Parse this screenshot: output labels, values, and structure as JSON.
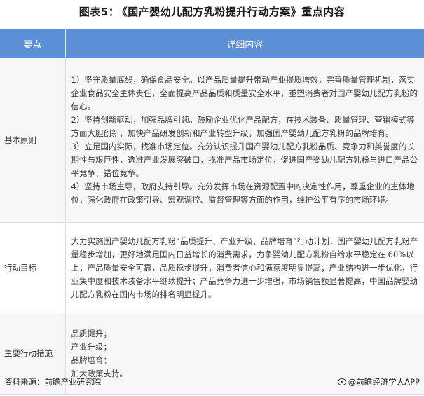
{
  "title": {
    "label": "图表5：",
    "text": "《国产婴幼儿配方乳粉提升行动方案》重点内容"
  },
  "table": {
    "headers": [
      "要点",
      "详细内容"
    ],
    "rows": [
      {
        "key": "基本原则",
        "paragraphs": [
          "1）坚守质量底线，确保食品安全。以产品质量提升带动产业提质增效，完善质量管理机制，落实企业食品安全主体责任，全面提高产品品质和质量安全水平，重塑消费者对国产婴幼儿配方乳粉的信心。",
          "2）坚持创新驱动，加强品牌引领。鼓励企业优化产品配方，在技术装备、质量管理、营销模式等方面大胆创新，加快产品研发创新和产业转型升级，加强国产婴幼儿配方乳粉的品牌培育。",
          "3）立足国内实际，找准市场定位。充分认识提升国产婴幼儿配方乳粉品质、竞争力和美誉度的长期性与艰巨性，选准产业发展突破口，找准产品市场定位，促进国产婴幼儿配方乳粉与进口产品公平竞争、错位竞争。",
          "4）坚持市场主导，政府支持引导。充分发挥市场在资源配置中的决定性作用，尊重企业的主体地位，强化政府在政策引导、宏观调控、监督管理等方面的作用，维护公平有序的市场环境。"
        ]
      },
      {
        "key": "行动目标",
        "paragraphs": [
          "大力实施国产婴幼儿配方乳粉“品质提升、产业升级、品牌培育”行动计划，国产婴幼儿配方乳粉产量稳步增加，更好地满足国内日益增长的消费需求，力争婴幼儿配方乳粉自给水平稳定在 60%以上；产品质量安全可靠，品质稳步提升，消费者信心和满意度明显提高；产业结构进一步优化，行业集中度和技术装备水平继续提升；产品竞争力进一步增强，市场销售额显著提高，中国品牌婴幼儿配方乳粉在国内市场的排名明显提升。"
        ]
      },
      {
        "key": "主要行动措施",
        "paragraphs": [
          "品质提升；",
          "产业升级；",
          "品牌培育；",
          "加大政策支持。"
        ]
      }
    ]
  },
  "footer": {
    "source": "资料来源：前瞻产业研究院",
    "brand": "@前瞻经济学人APP"
  }
}
